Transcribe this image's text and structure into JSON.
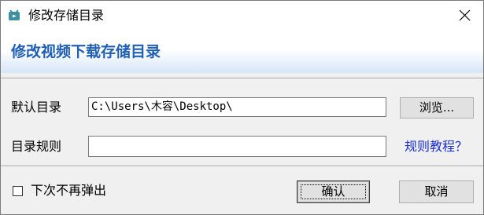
{
  "window": {
    "title": "修改存储目录",
    "icon": "video-app-icon",
    "close_icon": "close-icon"
  },
  "banner": {
    "heading": "修改视频下载存储目录"
  },
  "form": {
    "default_dir_label": "默认目录",
    "default_dir_value": "C:\\Users\\木容\\Desktop\\",
    "browse_label": "浏览...",
    "dir_rule_label": "目录规则",
    "dir_rule_value": "",
    "rule_tutorial_link": "规则教程？"
  },
  "footer": {
    "dont_show_again_label": "下次不再弹出",
    "dont_show_again_checked": false,
    "confirm_label": "确认",
    "cancel_label": "取消"
  },
  "colors": {
    "banner_text": "#1f5fb5",
    "link_text": "#1a2fd6",
    "icon_teal": "#3e8fa0"
  }
}
